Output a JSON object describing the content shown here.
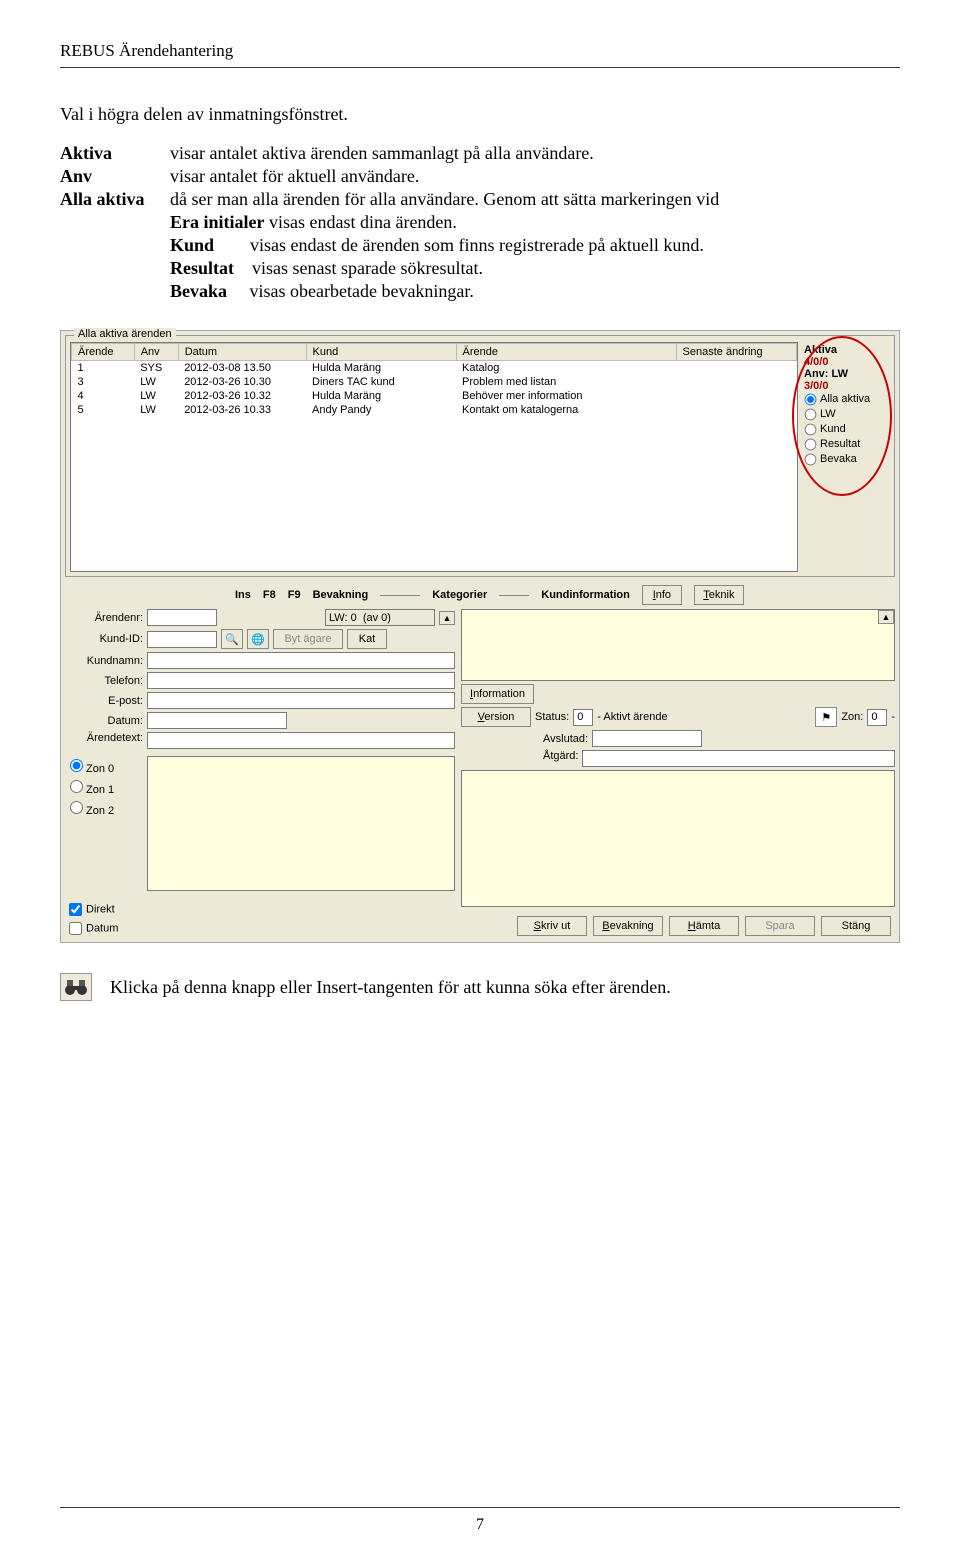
{
  "doc": {
    "header": "REBUS Ärendehantering",
    "intro": "Val i högra delen av inmatningsfönstret.",
    "defs": {
      "aktiva_term": "Aktiva",
      "aktiva_desc": "visar antalet aktiva ärenden sammanlagt på alla användare.",
      "anv_term": "Anv",
      "anv_desc": "visar antalet för aktuell användare.",
      "allaaktiva_term": "Alla aktiva",
      "allaaktiva_desc": "då ser man alla ärenden för alla användare. Genom att sätta markeringen vid",
      "era_term": "Era initialer",
      "era_desc": " visas endast dina ärenden.",
      "kund_term": "Kund",
      "kund_desc": "visas endast de ärenden som finns registrerade på aktuell kund.",
      "resultat_term": "Resultat",
      "resultat_desc": "visas senast sparade sökresultat.",
      "bevaka_term": "Bevaka",
      "bevaka_desc": "visas obearbetade bevakningar."
    },
    "binoc_text": "Klicka på denna knapp eller Insert-tangenten för att kunna söka efter ärenden.",
    "page_number": "7"
  },
  "app": {
    "group_title": "Alla aktiva ärenden",
    "columns": {
      "arende": "Ärende",
      "anv": "Anv",
      "datum": "Datum",
      "kund": "Kund",
      "arendetxt": "Ärende",
      "senaste": "Senaste ändring"
    },
    "rows": [
      {
        "nr": "1",
        "anv": "SYS",
        "datum": "2012-03-08 13.50",
        "kund": "Hulda Maräng",
        "txt": "Katalog"
      },
      {
        "nr": "3",
        "anv": "LW",
        "datum": "2012-03-26 10.30",
        "kund": "Diners TAC kund",
        "txt": "Problem med listan"
      },
      {
        "nr": "4",
        "anv": "LW",
        "datum": "2012-03-26 10.32",
        "kund": "Hulda Maräng",
        "txt": "Behöver mer information"
      },
      {
        "nr": "5",
        "anv": "LW",
        "datum": "2012-03-26 10.33",
        "kund": "Andy Pandy",
        "txt": "Kontakt om katalogerna"
      }
    ],
    "filter": {
      "aktiva_label": "Aktiva",
      "aktiva_value": "4/0/0",
      "anv_label": "Anv: LW",
      "anv_value": "3/0/0",
      "opt_allaaktiva": "Alla aktiva",
      "opt_lw": "LW",
      "opt_kund": "Kund",
      "opt_resultat": "Resultat",
      "opt_bevaka": "Bevaka"
    },
    "toolbar": {
      "ins": "Ins",
      "f8": "F8",
      "f9": "F9",
      "bevakning": "Bevakning",
      "kategorier": "Kategorier",
      "kundinformation": "Kundinformation",
      "info": "Info",
      "teknik": "Teknik"
    },
    "form": {
      "arendenr": "Ärendenr:",
      "kundid": "Kund-ID:",
      "kundnamn": "Kundnamn:",
      "telefon": "Telefon:",
      "epost": "E-post:",
      "datum": "Datum:",
      "arendetext": "Ärendetext:",
      "lw_count": "LW: 0  (av 0)",
      "bytagare": "Byt ägare",
      "kat": "Kat",
      "information": "Information",
      "version": "Version",
      "status": "Status:",
      "status_val": "0",
      "status_text": "- Aktivt ärende",
      "zon": "Zon:",
      "zon_val": "0",
      "avslutad": "Avslutad:",
      "atgard": "Åtgärd:",
      "zon0": "Zon 0",
      "zon1": "Zon 1",
      "zon2": "Zon 2",
      "direkt": "Direkt",
      "datum_chk": "Datum"
    },
    "buttons": {
      "skrivut": "Skriv ut",
      "bevakning": "Bevakning",
      "hamta": "Hämta",
      "spara": "Spara",
      "stang": "Stäng"
    }
  }
}
